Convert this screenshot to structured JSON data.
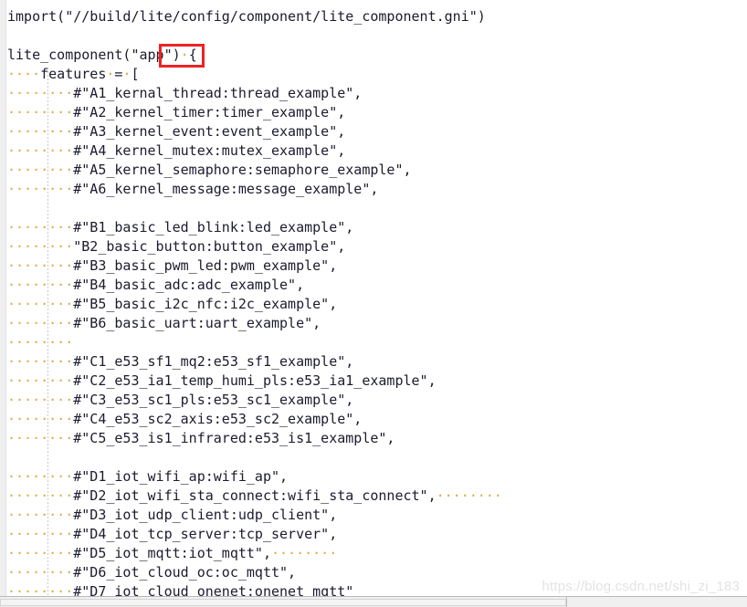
{
  "editor": {
    "language": "gn",
    "whitespace_marker": "·",
    "colors": {
      "text": "#1b1b2e",
      "whitespace_dot": "#e8a33d",
      "highlight_box": "#ee2222",
      "indent_guide": "#c8c8c8",
      "background": "#ffffff",
      "gutter": "#efefef",
      "watermark": "#e3e3e3"
    },
    "highlighted_token": "\"app\""
  },
  "watermark": {
    "text": "https://blog.csdn.net/shi_zi_183"
  },
  "lines": [
    {
      "indent": 0,
      "text": "import(\"//build/lite/config/component/lite_component.gni\")",
      "trailing": 0
    },
    {
      "indent": 0,
      "text": "",
      "trailing": 0
    },
    {
      "indent": 0,
      "text": "lite_component(\"app\")·{",
      "trailing": 0
    },
    {
      "indent": 4,
      "text": "features·=·[",
      "trailing": 0
    },
    {
      "indent": 8,
      "text": "#\"A1_kernal_thread:thread_example\",",
      "trailing": 0
    },
    {
      "indent": 8,
      "text": "#\"A2_kernel_timer:timer_example\",",
      "trailing": 0
    },
    {
      "indent": 8,
      "text": "#\"A3_kernel_event:event_example\",",
      "trailing": 0
    },
    {
      "indent": 8,
      "text": "#\"A4_kernel_mutex:mutex_example\",",
      "trailing": 0
    },
    {
      "indent": 8,
      "text": "#\"A5_kernel_semaphore:semaphore_example\",",
      "trailing": 0
    },
    {
      "indent": 8,
      "text": "#\"A6_kernel_message:message_example\",",
      "trailing": 0
    },
    {
      "indent": 0,
      "text": "",
      "trailing": 0
    },
    {
      "indent": 8,
      "text": "#\"B1_basic_led_blink:led_example\",",
      "trailing": 0
    },
    {
      "indent": 8,
      "text": "\"B2_basic_button:button_example\",",
      "trailing": 0
    },
    {
      "indent": 8,
      "text": "#\"B3_basic_pwm_led:pwm_example\",",
      "trailing": 0
    },
    {
      "indent": 8,
      "text": "#\"B4_basic_adc:adc_example\",",
      "trailing": 0
    },
    {
      "indent": 8,
      "text": "#\"B5_basic_i2c_nfc:i2c_example\",",
      "trailing": 0
    },
    {
      "indent": 8,
      "text": "#\"B6_basic_uart:uart_example\",",
      "trailing": 0
    },
    {
      "indent": 8,
      "text": "",
      "trailing": 0
    },
    {
      "indent": 8,
      "text": "#\"C1_e53_sf1_mq2:e53_sf1_example\",",
      "trailing": 0
    },
    {
      "indent": 8,
      "text": "#\"C2_e53_ia1_temp_humi_pls:e53_ia1_example\",",
      "trailing": 0
    },
    {
      "indent": 8,
      "text": "#\"C3_e53_sc1_pls:e53_sc1_example\",",
      "trailing": 0
    },
    {
      "indent": 8,
      "text": "#\"C4_e53_sc2_axis:e53_sc2_example\",",
      "trailing": 0
    },
    {
      "indent": 8,
      "text": "#\"C5_e53_is1_infrared:e53_is1_example\",",
      "trailing": 0
    },
    {
      "indent": 0,
      "text": "",
      "trailing": 0
    },
    {
      "indent": 8,
      "text": "#\"D1_iot_wifi_ap:wifi_ap\",",
      "trailing": 0
    },
    {
      "indent": 8,
      "text": "#\"D2_iot_wifi_sta_connect:wifi_sta_connect\",",
      "trailing": 8
    },
    {
      "indent": 8,
      "text": "#\"D3_iot_udp_client:udp_client\",",
      "trailing": 0
    },
    {
      "indent": 8,
      "text": "#\"D4_iot_tcp_server:tcp_server\",",
      "trailing": 0
    },
    {
      "indent": 8,
      "text": "#\"D5_iot_mqtt:iot_mqtt\",",
      "trailing": 8
    },
    {
      "indent": 8,
      "text": "#\"D6_iot_cloud_oc:oc_mqtt\",",
      "trailing": 0
    },
    {
      "indent": 8,
      "text": "#\"D7_iot_cloud_onenet:onenet_mqtt\"",
      "trailing": 0
    }
  ]
}
